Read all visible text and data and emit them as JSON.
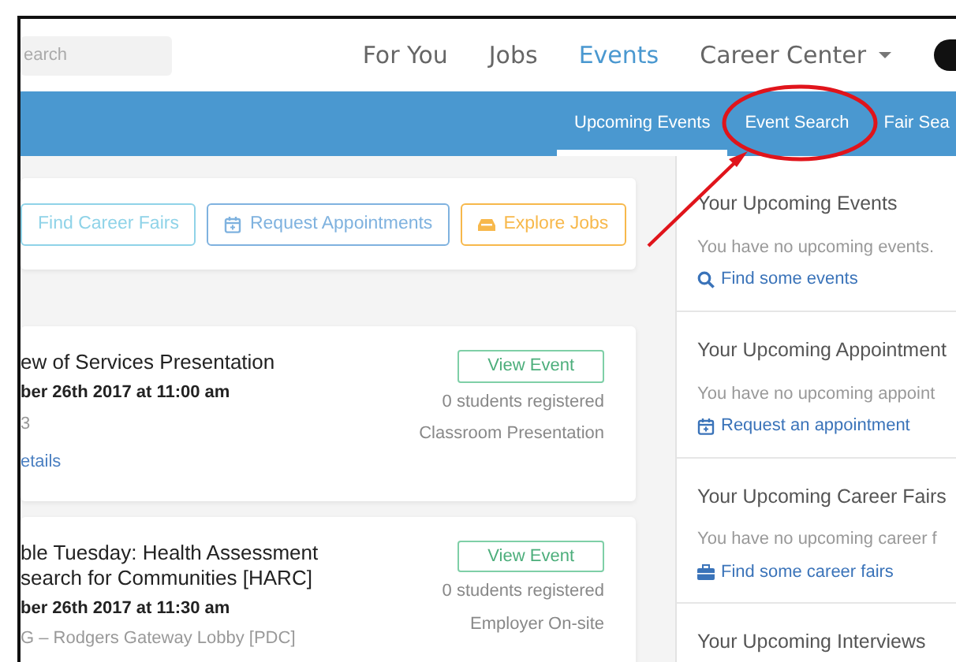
{
  "top_nav": {
    "search": {
      "placeholder": "earch"
    },
    "items": [
      {
        "label": "For You",
        "selected": false,
        "dropdown": false
      },
      {
        "label": "Jobs",
        "selected": false,
        "dropdown": false
      },
      {
        "label": "Events",
        "selected": true,
        "dropdown": false
      },
      {
        "label": "Career Center",
        "selected": false,
        "dropdown": true
      }
    ]
  },
  "sub_nav": {
    "tabs": [
      {
        "label": "Upcoming Events",
        "selected": true
      },
      {
        "label": "Event Search",
        "selected": false
      },
      {
        "label": "Fair Sea",
        "selected": false
      }
    ]
  },
  "quick_actions": [
    {
      "label": "Find Career Fairs",
      "kind": "plain",
      "color": "#8fd3e8"
    },
    {
      "label": "Request Appointments",
      "kind": "calendar",
      "color": "#7fb2df"
    },
    {
      "label": "Explore Jobs",
      "kind": "inbox",
      "color": "#f7b84b"
    }
  ],
  "events": [
    {
      "title_lines": [
        "ew of Services Presentation"
      ],
      "date": "ber 26th 2017 at 11:00 am",
      "location": "3",
      "link": "etails",
      "button": "View Event",
      "registered": "0 students registered",
      "type": "Classroom Presentation"
    },
    {
      "title_lines": [
        "ble Tuesday: Health Assessment",
        "search for Communities [HARC]"
      ],
      "date": "ber 26th 2017 at 11:30 am",
      "location": "G – Rodgers Gateway Lobby [PDC]",
      "button": "View Event",
      "registered": "0 students registered",
      "type": "Employer On-site"
    }
  ],
  "sidebar": [
    {
      "title": "Your Upcoming Events",
      "text": "You have no upcoming events.",
      "link": "Find some events",
      "kind": "search"
    },
    {
      "title": "Your Upcoming Appointment",
      "text": "You have no upcoming appoint",
      "link": "Request an appointment",
      "kind": "calendar"
    },
    {
      "title": "Your Upcoming Career Fairs",
      "text": "You have no upcoming career f",
      "link": "Find some career fairs",
      "kind": "briefcase"
    },
    {
      "title": "Your Upcoming Interviews"
    }
  ]
}
